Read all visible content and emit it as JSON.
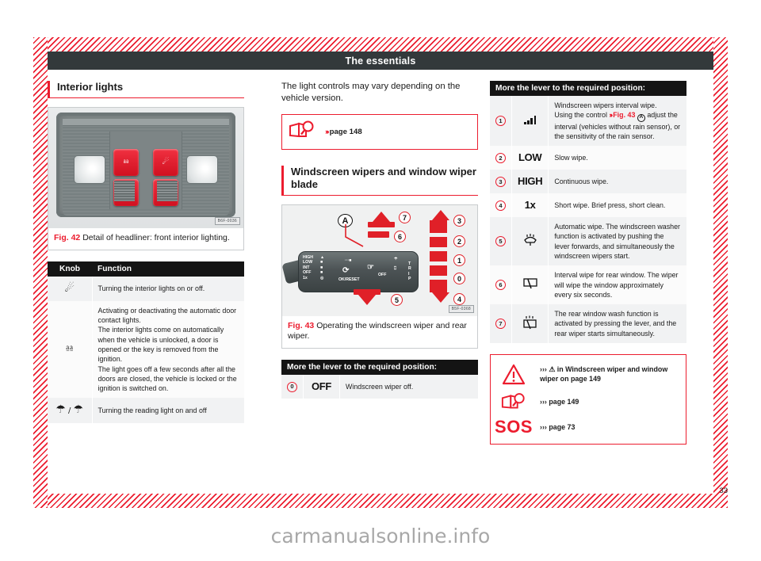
{
  "header": {
    "running_head": "The essentials"
  },
  "page_number": "33",
  "watermark": "carmanualsonline.info",
  "left": {
    "heading": "Interior lights",
    "figure": {
      "label": "Fig. 42",
      "caption": "Detail of headliner: front interior lighting.",
      "code": "B6F-0036"
    },
    "table": {
      "headers": [
        "Knob",
        "Function"
      ],
      "rows": [
        {
          "knob_icon": "interior-light-icon",
          "function": "Turning the interior lights on or off."
        },
        {
          "knob_icon": "door-contact-light-icon",
          "function": "Activating or deactivating the automatic door contact lights.\nThe interior lights come on automatically when the vehicle is unlocked, a door is opened or the key is removed from the ignition.\nThe light goes off a few seconds after all the doors are closed, the vehicle is locked or the ignition is switched on."
        },
        {
          "knob_icon": "reading-light-pair-icon",
          "function": "Turning the reading light on and off"
        }
      ]
    }
  },
  "middle": {
    "intro": "The light controls may vary depending on the vehicle version.",
    "ref_box": {
      "icon": "book-magnifier-icon",
      "chevrons": "›››",
      "text": "page 148"
    },
    "heading": "Windscreen wipers and window wiper blade",
    "figure": {
      "label": "Fig. 43",
      "caption": "Operating the windscreen wiper and rear wiper.",
      "code": "B5F-0368",
      "callouts": [
        "A",
        "0",
        "1",
        "2",
        "3",
        "4",
        "5",
        "6",
        "7"
      ],
      "stalk_positions": [
        "HIGH",
        "LOW",
        "INT",
        "OFF",
        "1x"
      ],
      "stalk_labels": [
        "OK/RESET",
        "OFF",
        "TRIP"
      ]
    },
    "table": {
      "header": "More the lever to the required position:",
      "rows": [
        {
          "num": "0",
          "icon_text": "OFF",
          "icon_kind": "word",
          "text": "Windscreen wiper off."
        }
      ]
    }
  },
  "right": {
    "table": {
      "header": "More the lever to the required position:",
      "rows": [
        {
          "num": "1",
          "icon_kind": "bars",
          "icon_text": "",
          "text_runs": [
            {
              "t": "Windscreen wipers interval wipe.\nUsing the control "
            },
            {
              "t": "››› ",
              "c": "red"
            },
            {
              "t": "Fig. 43",
              "c": "redbold"
            },
            {
              "t": " Ⓐ ",
              "c": "circA"
            },
            {
              "t": "adjust the interval (vehicles without rain sensor), or the sensitivity of the rain sensor."
            }
          ],
          "text": "Windscreen wipers interval wipe. Using the control ››› Fig. 43 A adjust the interval (vehicles without rain sensor), or the sensitivity of the rain sensor."
        },
        {
          "num": "2",
          "icon_kind": "word",
          "icon_text": "LOW",
          "text": "Slow wipe."
        },
        {
          "num": "3",
          "icon_kind": "word",
          "icon_text": "HIGH",
          "text": "Continuous wipe."
        },
        {
          "num": "4",
          "icon_kind": "word",
          "icon_text": "1x",
          "text": "Short wipe. Brief press, short clean."
        },
        {
          "num": "5",
          "icon_kind": "glyph",
          "icon_text": "windscreen-washer-icon",
          "text": "Automatic wipe. The windscreen washer function is activated by pushing the lever forwards, and simultaneously the windscreen wipers start."
        },
        {
          "num": "6",
          "icon_kind": "glyph",
          "icon_text": "rear-wiper-icon",
          "text": "Interval wipe for rear window. The wiper will wipe the window approximately every six seconds."
        },
        {
          "num": "7",
          "icon_kind": "glyph",
          "icon_text": "rear-washer-icon",
          "text": "The rear window wash function is activated by pressing the lever, and the rear wiper starts simultaneously."
        }
      ]
    },
    "notes": [
      {
        "icon": "warning-triangle-icon",
        "text": "››› ⚠ in Windscreen wiper and window wiper on page 149"
      },
      {
        "icon": "book-magnifier-icon",
        "text": "››› page 149"
      },
      {
        "icon": "sos-icon",
        "icon_text": "SOS",
        "text": "››› page 73"
      }
    ]
  },
  "colors": {
    "accent_red": "#ec1c2e",
    "header_bar": "#33393b",
    "table_header": "#141414",
    "row_alt": "#f1f2f3"
  }
}
